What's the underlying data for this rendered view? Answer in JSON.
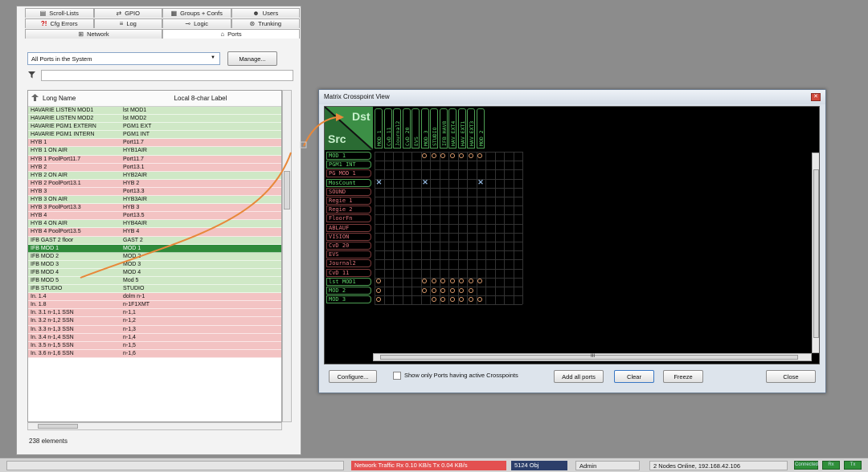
{
  "left_panel": {
    "tabs_row1": [
      {
        "label": "Scroll-Lists",
        "icon": "list-icon"
      },
      {
        "label": "GPIO",
        "icon": "gpio-icon"
      },
      {
        "label": "Groups + Confs",
        "icon": "groups-icon"
      },
      {
        "label": "Users",
        "icon": "users-icon"
      }
    ],
    "tabs_row2": [
      {
        "label": "Cfg Errors",
        "icon": "error-icon"
      },
      {
        "label": "Log",
        "icon": "log-icon"
      },
      {
        "label": "Logic",
        "icon": "logic-icon"
      },
      {
        "label": "Trunking",
        "icon": "trunking-icon"
      }
    ],
    "tabs_row3": [
      {
        "label": "Network",
        "icon": "network-icon"
      },
      {
        "label": "Ports",
        "icon": "ports-icon"
      }
    ],
    "filter_select": "All Ports in the System",
    "manage_label": "Manage...",
    "columns": [
      "Long Name",
      "Local 8-char Label"
    ],
    "rows": [
      [
        "HAVARIE LISTEN MOD1",
        "lst MOD1",
        "g"
      ],
      [
        "HAVARIE LISTEN MOD2",
        "lst MOD2",
        "g"
      ],
      [
        "HAVARIE PGM1 EXTERN",
        "PGM1 EXT",
        "g"
      ],
      [
        "HAVARIE PGM1 INTERN",
        "PGM1 INT",
        "g"
      ],
      [
        "HYB 1",
        "Port11.7",
        "r"
      ],
      [
        "HYB 1 ON AIR",
        "HYB1AIR",
        "g"
      ],
      [
        "HYB 1 PoolPort11.7",
        "Port11.7",
        "r"
      ],
      [
        "HYB 2",
        "Port13.1",
        "r"
      ],
      [
        "HYB 2 ON AIR",
        "HYB2AIR",
        "g"
      ],
      [
        "HYB 2 PoolPort13.1",
        "HYB 2",
        "r"
      ],
      [
        "HYB 3",
        "Port13.3",
        "r"
      ],
      [
        "HYB 3 ON AIR",
        "HYB3AIR",
        "g"
      ],
      [
        "HYB 3 PoolPort13.3",
        "HYB 3",
        "r"
      ],
      [
        "HYB 4",
        "Port13.5",
        "r"
      ],
      [
        "HYB 4 ON AIR",
        "HYB4AIR",
        "g"
      ],
      [
        "HYB 4 PoolPort13.5",
        "HYB 4",
        "r"
      ],
      [
        "IFB GAST 2 floor",
        "GAST 2",
        "g"
      ],
      [
        "IFB MOD 1",
        "MOD 1",
        "s"
      ],
      [
        "IFB MOD 2",
        "MOD 2",
        "g"
      ],
      [
        "IFB MOD 3",
        "MOD 3",
        "g"
      ],
      [
        "IFB MOD 4",
        "MOD 4",
        "g"
      ],
      [
        "IFB MOD 5",
        "Mod 5",
        "g"
      ],
      [
        "IFB STUDIO",
        "STUDIO",
        "g"
      ],
      [
        "In. 1.4",
        "dolm n-1",
        "r"
      ],
      [
        "In. 1.8",
        "n-1F1XMT",
        "r"
      ],
      [
        "In. 3.1 n-1,1 SSN",
        "n-1,1",
        "r"
      ],
      [
        "In. 3.2 n-1,2 SSN",
        "n-1,2",
        "r"
      ],
      [
        "In. 3.3 n-1,3 SSN",
        "n-1,3",
        "r"
      ],
      [
        "In. 3.4 n-1,4 SSN",
        "n-1,4",
        "r"
      ],
      [
        "In. 3.5 n-1,5 SSN",
        "n-1,5",
        "r"
      ],
      [
        "In. 3.6 n-1,6 SSN",
        "n-1,6",
        "r"
      ]
    ],
    "count_label": "238 elements"
  },
  "matrix": {
    "title": "Matrix Crosspoint View",
    "corner_dst": "Dst",
    "corner_src": "Src",
    "columns": [
      "MOD 1",
      "CvD 11",
      "Journal2",
      "CvD 20",
      "EVS",
      "MOD 3",
      "STUDIO",
      "IFB HAV8",
      "HAV EXT4",
      "HAV EXT1",
      "HAV EXT3",
      "MOD 2"
    ],
    "rows": [
      {
        "label": "MOD 1",
        "color": "green"
      },
      {
        "label": "PGM1 INT",
        "color": "green"
      },
      {
        "label": "PG MOD 1",
        "color": "red"
      },
      {
        "label": "MosCount",
        "color": "green"
      },
      {
        "label": "SOUND",
        "color": "red"
      },
      {
        "label": "Regie 1",
        "color": "red"
      },
      {
        "label": "Regie 2",
        "color": "red"
      },
      {
        "label": "FloorFn",
        "color": "red"
      },
      {
        "label": "ABLAUF",
        "color": "red"
      },
      {
        "label": "VISION",
        "color": "red"
      },
      {
        "label": "CvD 20",
        "color": "red"
      },
      {
        "label": "EVS",
        "color": "red"
      },
      {
        "label": "Journal2",
        "color": "red"
      },
      {
        "label": "CvD 11",
        "color": "red"
      },
      {
        "label": "lst MOD1",
        "color": "green"
      },
      {
        "label": "MOD 2",
        "color": "green"
      },
      {
        "label": "MOD 3",
        "color": "green"
      }
    ],
    "crosspoints": [
      {
        "row": 0,
        "cols": [
          5,
          6,
          7,
          8,
          9,
          10,
          11
        ],
        "kind": "circle"
      },
      {
        "row": 3,
        "cols": [
          0,
          5,
          11
        ],
        "kind": "x"
      },
      {
        "row": 14,
        "cols": [
          0,
          5,
          6,
          7,
          8,
          9,
          10,
          11
        ],
        "kind": "circle"
      },
      {
        "row": 15,
        "cols": [
          0,
          5,
          6,
          7,
          8,
          9,
          10
        ],
        "kind": "circle"
      },
      {
        "row": 16,
        "cols": [
          0,
          6,
          7,
          8,
          9,
          10,
          11
        ],
        "kind": "circle"
      }
    ],
    "scroll_mid": "III",
    "buttons": {
      "configure": "Configure...",
      "show_only": "Show only Ports having active Crosspoints",
      "add_all": "Add all ports",
      "clear": "Clear",
      "freeze": "Freeze",
      "close": "Close"
    }
  },
  "status_bar": {
    "network": "Network Traffic Rx 0.10 KB/s  Tx 0.04 KB/s",
    "objects": "5124 Obj",
    "user": "Admin",
    "nodes": "2 Nodes Online, 192.168.42.106",
    "indicators": [
      "Connected",
      "Rx",
      "Tx"
    ]
  },
  "colors": {
    "row_green": "#cfe8c6",
    "row_red": "#f3c3c3",
    "row_selected": "#2e8a3a",
    "matrix_green": "#5ed36a",
    "matrix_red": "#e0747c",
    "crosspoint": "#d99a6c",
    "arrow": "#e8883a"
  }
}
